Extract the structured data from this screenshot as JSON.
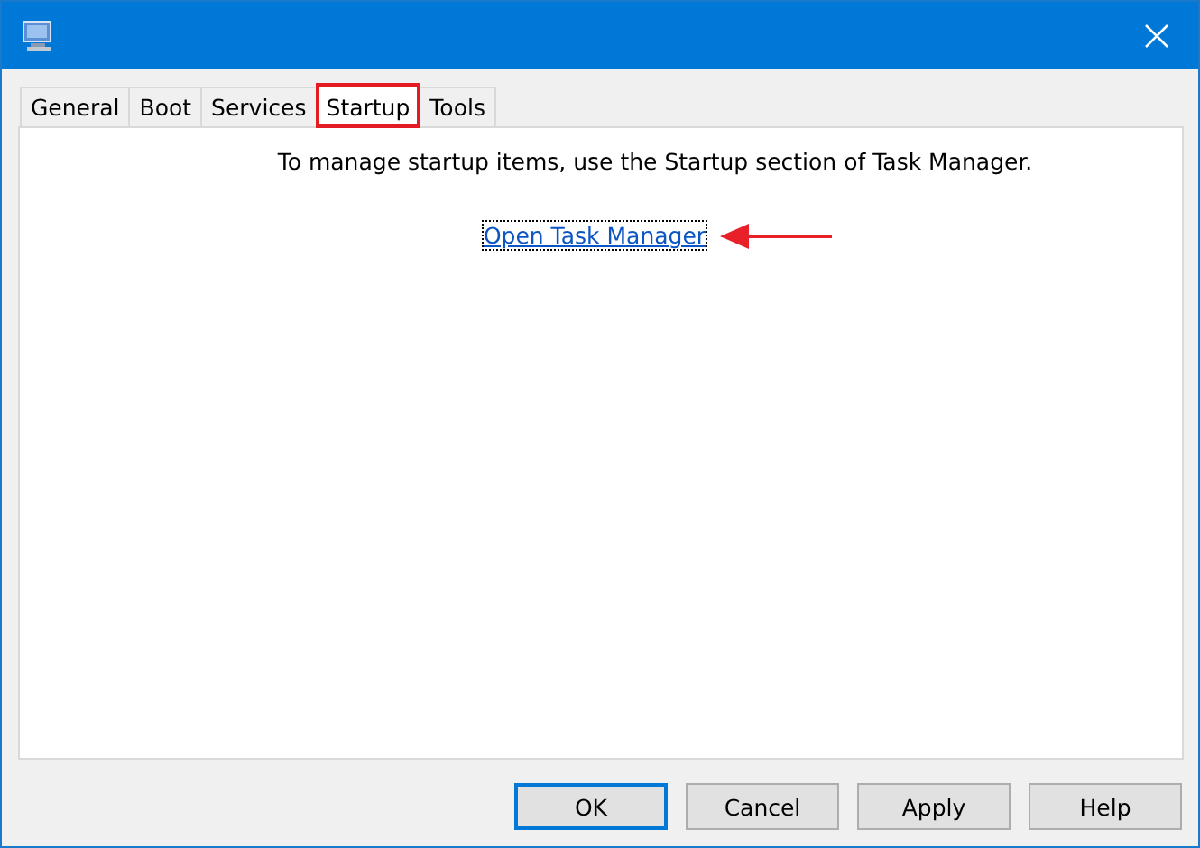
{
  "window": {
    "title_icon": true
  },
  "tabs": [
    {
      "label": "General",
      "selected": false,
      "highlighted": false
    },
    {
      "label": "Boot",
      "selected": false,
      "highlighted": false
    },
    {
      "label": "Services",
      "selected": false,
      "highlighted": false
    },
    {
      "label": "Startup",
      "selected": true,
      "highlighted": true
    },
    {
      "label": "Tools",
      "selected": false,
      "highlighted": false
    }
  ],
  "panel": {
    "message": "To manage startup items, use the Startup section of Task Manager.",
    "link": {
      "text": "Open Task Manager",
      "focused": true,
      "pointed_by_arrow": true
    }
  },
  "buttons": [
    {
      "label": "OK",
      "default": true
    },
    {
      "label": "Cancel",
      "default": false
    },
    {
      "label": "Apply",
      "default": false
    },
    {
      "label": "Help",
      "default": false
    }
  ]
}
